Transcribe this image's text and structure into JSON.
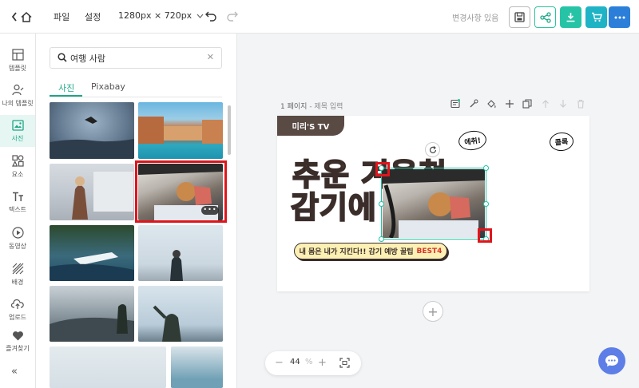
{
  "toolbar": {
    "file_label": "파일",
    "settings_label": "설정",
    "size_label": "1280px × 720px",
    "status_text": "변경사항 있음",
    "icons": [
      "home-icon",
      "undo-icon",
      "redo-icon",
      "save-icon",
      "share-icon",
      "download-icon",
      "cart-icon",
      "more-icon"
    ],
    "colors": {
      "download": "#27c3a7",
      "cart": "#1fb3c6",
      "more": "#2b7fd9",
      "accent": "#1ea787"
    }
  },
  "sidebar": {
    "items": [
      {
        "label": "템플릿",
        "icon": "template-icon"
      },
      {
        "label": "나의 템플릿",
        "icon": "my-template-icon"
      },
      {
        "label": "사진",
        "icon": "photo-icon",
        "active": true
      },
      {
        "label": "요소",
        "icon": "elements-icon"
      },
      {
        "label": "텍스트",
        "icon": "text-icon"
      },
      {
        "label": "동영상",
        "icon": "video-icon"
      },
      {
        "label": "배경",
        "icon": "background-icon"
      },
      {
        "label": "업로드",
        "icon": "upload-icon"
      },
      {
        "label": "즐겨찾기",
        "icon": "heart-icon"
      }
    ],
    "collapse_label": "«"
  },
  "panel": {
    "search_value": "여행 사람",
    "clear_label": "✕",
    "tabs": [
      {
        "label": "사진",
        "active": true
      },
      {
        "label": "Pixabay",
        "active": false
      }
    ],
    "thumbnail_more": "•••"
  },
  "canvas": {
    "page_number": "1 페이지",
    "page_title_placeholder": "- 제목 입력",
    "tv_tag": "미리'S TV",
    "bubble1": "에취!",
    "bubble2": "콜록",
    "headline_line1": "추운 겨울철",
    "headline_line2": "감기에",
    "pill_text": "내 몸은 내가 지킨다!! 감기 예방 꿀팁",
    "pill_accent": "BEST4",
    "add_page_label": "+"
  },
  "zoom": {
    "value": "44",
    "unit": "%",
    "minus": "−",
    "plus": "+"
  }
}
